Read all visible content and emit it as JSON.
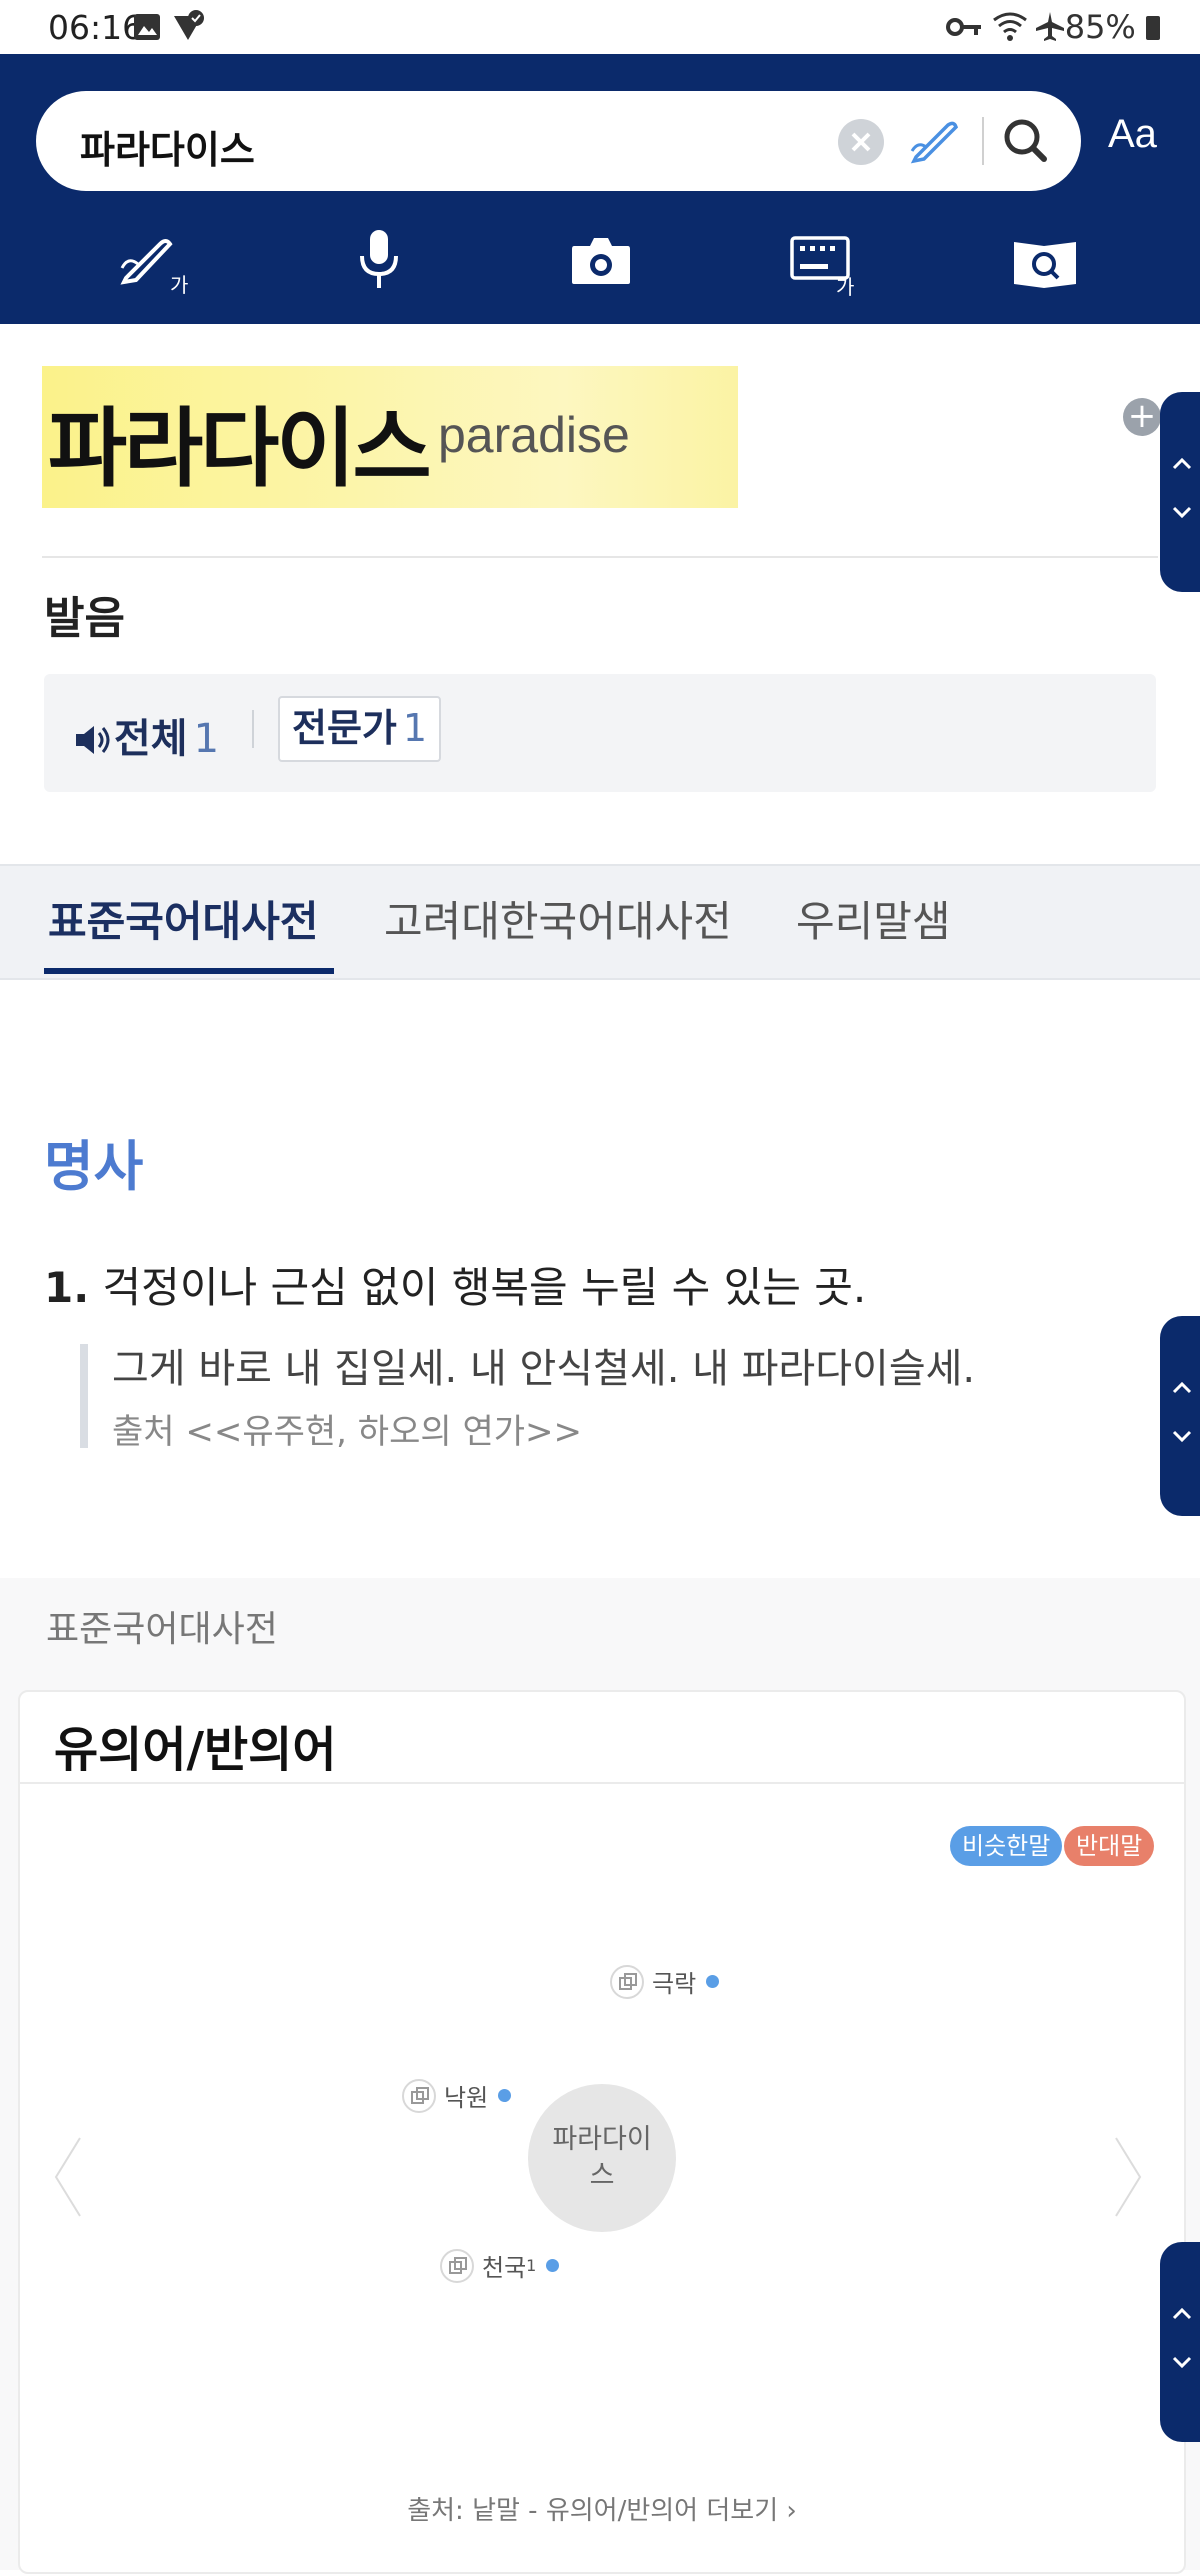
{
  "status_bar": {
    "time": "06:16",
    "battery": "85%"
  },
  "search": {
    "query": "파라다이스"
  },
  "header": {
    "font_size_label": "Aa"
  },
  "tools": [
    "handwriting-icon",
    "microphone-icon",
    "camera-icon",
    "keyboard-icon",
    "book-search-icon"
  ],
  "word": {
    "headword": "파라다이스",
    "original": "paradise",
    "add_label": "+"
  },
  "pronunciation": {
    "title": "발음",
    "all_label": "전체",
    "all_count": "1",
    "expert_label": "전문가",
    "expert_count": "1"
  },
  "tabs": [
    {
      "label": "표준국어대사전",
      "active": true
    },
    {
      "label": "고려대한국어대사전",
      "active": false
    },
    {
      "label": "우리말샘",
      "active": false
    }
  ],
  "entry": {
    "part_of_speech": "명사",
    "sense_number": "1.",
    "definition": "걱정이나 근심 없이 행복을 누릴 수 있는 곳.",
    "example": "그게 바로 내 집일세. 내 안식철세. 내 파라다이슬세.",
    "example_source": "출처 <<유주현, 하오의 연가>>"
  },
  "source_dictionary": "표준국어대사전",
  "synonyms": {
    "title": "유의어/반의어",
    "legend_similar": "비슷한말",
    "legend_opposite": "반대말",
    "center": "파라다이스",
    "nodes": [
      {
        "label": "극락",
        "sup": ""
      },
      {
        "label": "낙원",
        "sup": ""
      },
      {
        "label": "천국",
        "sup": "1"
      }
    ],
    "source": "출처: 낱말 - 유의어/반의어 더보기 ›",
    "colors": {
      "similar": "#5a9ee6",
      "opposite": "#e8806a"
    }
  },
  "colors": {
    "header": "#0b2a6b",
    "accent_blue": "#4d7bd0",
    "highlight": "#fbf28a"
  }
}
